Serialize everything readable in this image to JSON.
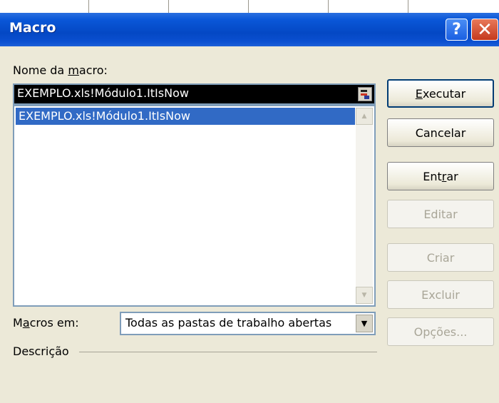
{
  "window": {
    "title": "Macro",
    "help_label": "?",
    "close_label": "✕"
  },
  "form": {
    "name_label_prefix": "Nome da ",
    "name_label_hotkey": "m",
    "name_label_suffix": "acro:",
    "name_value": "EXEMPLO.xls!Módulo1.ItIsNow",
    "list_items": [
      "EXEMPLO.xls!Módulo1.ItIsNow"
    ],
    "macros_in_label_prefix": "M",
    "macros_in_label_hotkey": "a",
    "macros_in_label_suffix": "cros em:",
    "macros_in_value": "Todas as pastas de trabalho abertas",
    "description_label": "Descrição"
  },
  "buttons": {
    "run": {
      "hotkey": "E",
      "rest": "xecutar"
    },
    "cancel": {
      "label": "Cancelar"
    },
    "step_into": {
      "prefix": "Ent",
      "hotkey": "r",
      "rest": "ar"
    },
    "edit": {
      "label": "Editar"
    },
    "create": {
      "label": "Criar"
    },
    "delete": {
      "label": "Excluir"
    },
    "options": {
      "label": "Opções..."
    }
  }
}
